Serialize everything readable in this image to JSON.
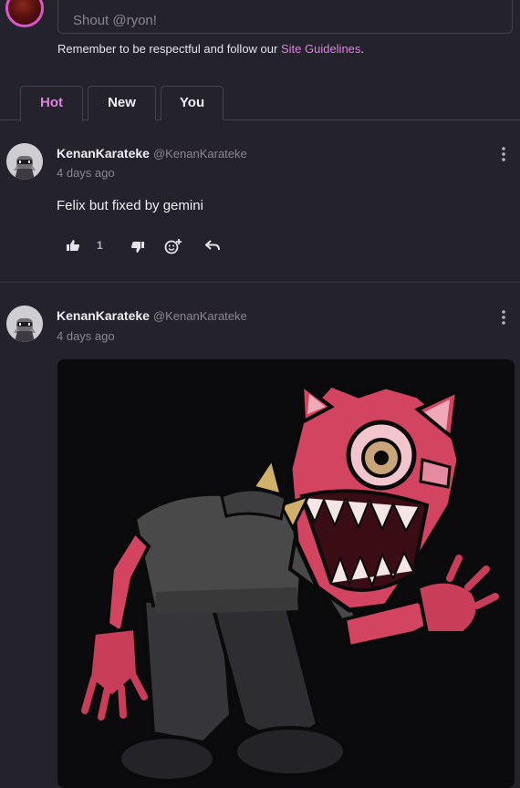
{
  "composer": {
    "placeholder": "Shout @ryon!",
    "notice_prefix": "Remember to be respectful and follow our ",
    "notice_link": "Site Guidelines",
    "notice_suffix": "."
  },
  "tabs": [
    {
      "label": "Hot",
      "active": true
    },
    {
      "label": "New",
      "active": false
    },
    {
      "label": "You",
      "active": false
    }
  ],
  "posts": [
    {
      "author": "KenanKarateke",
      "handle": "@KenanKarateke",
      "time": "4 days ago",
      "text": "Felix but fixed by gemini",
      "likes": "1"
    },
    {
      "author": "KenanKarateke",
      "handle": "@KenanKarateke",
      "time": "4 days ago",
      "image": "pink-robot-fox-illustration"
    }
  ],
  "colors": {
    "accent": "#e27fe4",
    "background": "#24222a",
    "border": "#44414c"
  }
}
